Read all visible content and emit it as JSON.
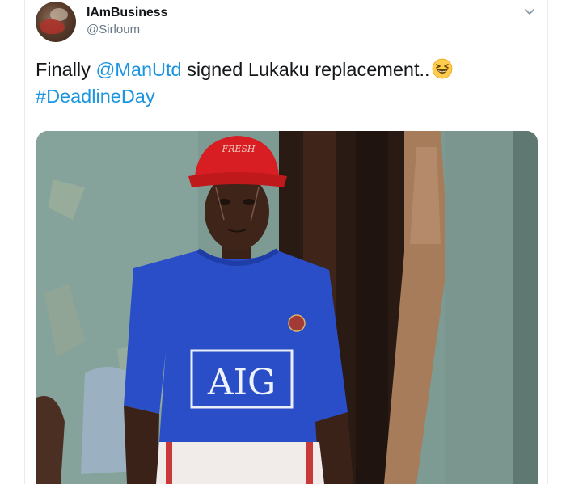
{
  "tweet": {
    "display_name": "IAmBusiness",
    "handle": "@Sirloum",
    "text_before": "Finally ",
    "mention": "@ManUtd",
    "text_after": " signed Lukaku replacement..",
    "hashtag": "#DeadlineDay",
    "emoji": "grinning-squinting-face"
  },
  "media": {
    "jersey_sponsor": "AIG",
    "cap_text": "FRESH"
  },
  "colors": {
    "link": "#1b95e0",
    "name": "#14171a",
    "handle": "#657786",
    "jersey": "#2a4ec8",
    "cap": "#d81e22"
  }
}
